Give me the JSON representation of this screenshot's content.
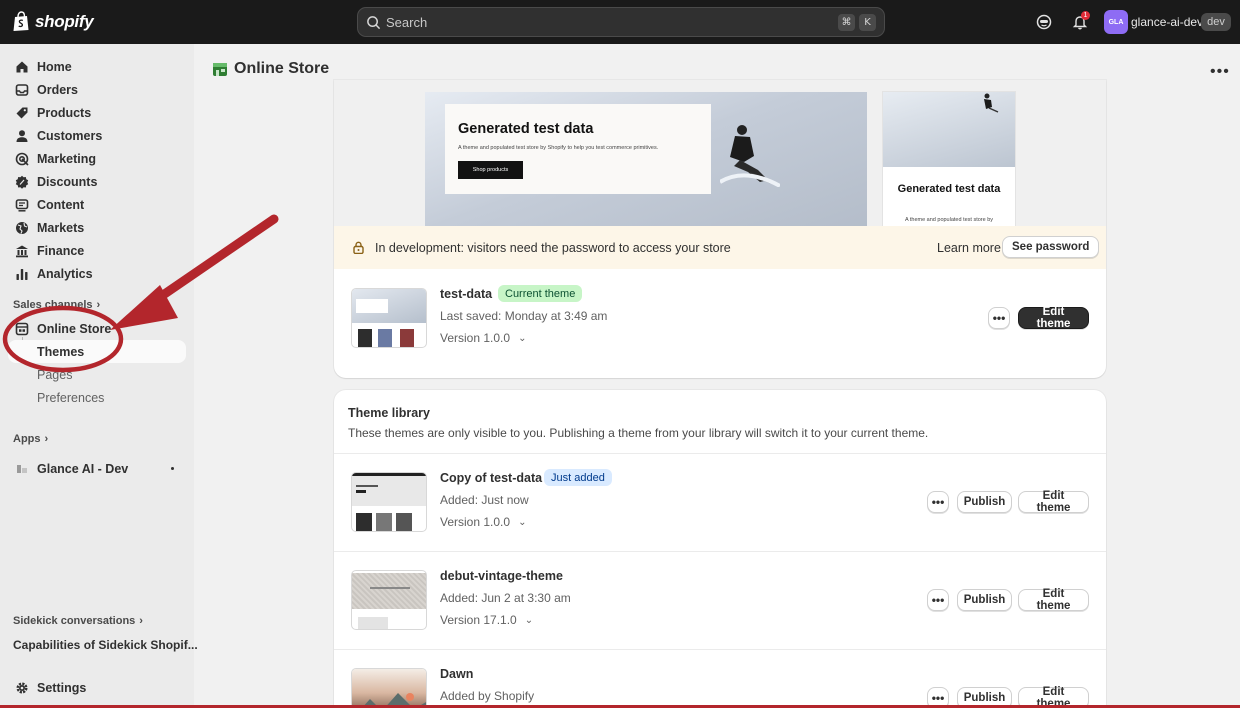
{
  "topbar": {
    "brand": "shopify",
    "search_placeholder": "Search",
    "shortcut_keys": [
      "⌘",
      "K"
    ],
    "notification_count": "1",
    "avatar_initials": "GLA",
    "store_name": "glance-ai-dev",
    "store_badge": "dev"
  },
  "sidebar": {
    "items": [
      {
        "label": "Home",
        "icon": "home-icon"
      },
      {
        "label": "Orders",
        "icon": "orders-icon"
      },
      {
        "label": "Products",
        "icon": "tag-icon"
      },
      {
        "label": "Customers",
        "icon": "person-icon"
      },
      {
        "label": "Marketing",
        "icon": "target-icon"
      },
      {
        "label": "Discounts",
        "icon": "discount-icon"
      },
      {
        "label": "Content",
        "icon": "content-icon"
      },
      {
        "label": "Markets",
        "icon": "globe-icon"
      },
      {
        "label": "Finance",
        "icon": "bank-icon"
      },
      {
        "label": "Analytics",
        "icon": "bar-chart-icon"
      }
    ],
    "sales_channels_label": "Sales channels",
    "online_store_label": "Online Store",
    "online_store_subitems": [
      "Themes",
      "Pages",
      "Preferences"
    ],
    "apps_label": "Apps",
    "app_item": "Glance AI - Dev",
    "sidekick_label": "Sidekick conversations",
    "sidekick_item": "Capabilities of Sidekick Shopif...",
    "settings_label": "Settings"
  },
  "page": {
    "title": "Online Store"
  },
  "current_theme_card": {
    "preview_heading": "Generated test data",
    "preview_sub": "A theme and populated test store by Shopify to help you test commerce primitives.",
    "preview_button": "Shop products",
    "mobile_heading": "Generated test data",
    "mobile_sub": "A theme and populated test store by Shopify to help you test commerce",
    "dev_banner": "In development: visitors need the password to access your store",
    "learn_more": "Learn more",
    "see_password": "See password",
    "theme_name": "test-data",
    "theme_badge": "Current theme",
    "last_saved": "Last saved: Monday at 3:49 am",
    "version": "Version 1.0.0",
    "edit_theme": "Edit theme"
  },
  "library": {
    "title": "Theme library",
    "description": "These themes are only visible to you. Publishing a theme from your library will switch it to your current theme.",
    "publish_label": "Publish",
    "edit_label": "Edit theme",
    "themes": [
      {
        "name": "Copy of test-data",
        "badge": "Just added",
        "meta": "Added: Just now",
        "version": "Version 1.0.0"
      },
      {
        "name": "debut-vintage-theme",
        "badge": "",
        "meta": "Added: Jun 2 at 3:30 am",
        "version": "Version 17.1.0"
      },
      {
        "name": "Dawn",
        "badge": "",
        "meta": "Added by Shopify",
        "version": ""
      }
    ]
  },
  "colors": {
    "topbar": "#1a1a1a",
    "sidebar": "#ebebeb",
    "annotation_red": "#b3262c",
    "green_badge": "#c7f5c7",
    "blue_badge": "#d9eaff"
  }
}
